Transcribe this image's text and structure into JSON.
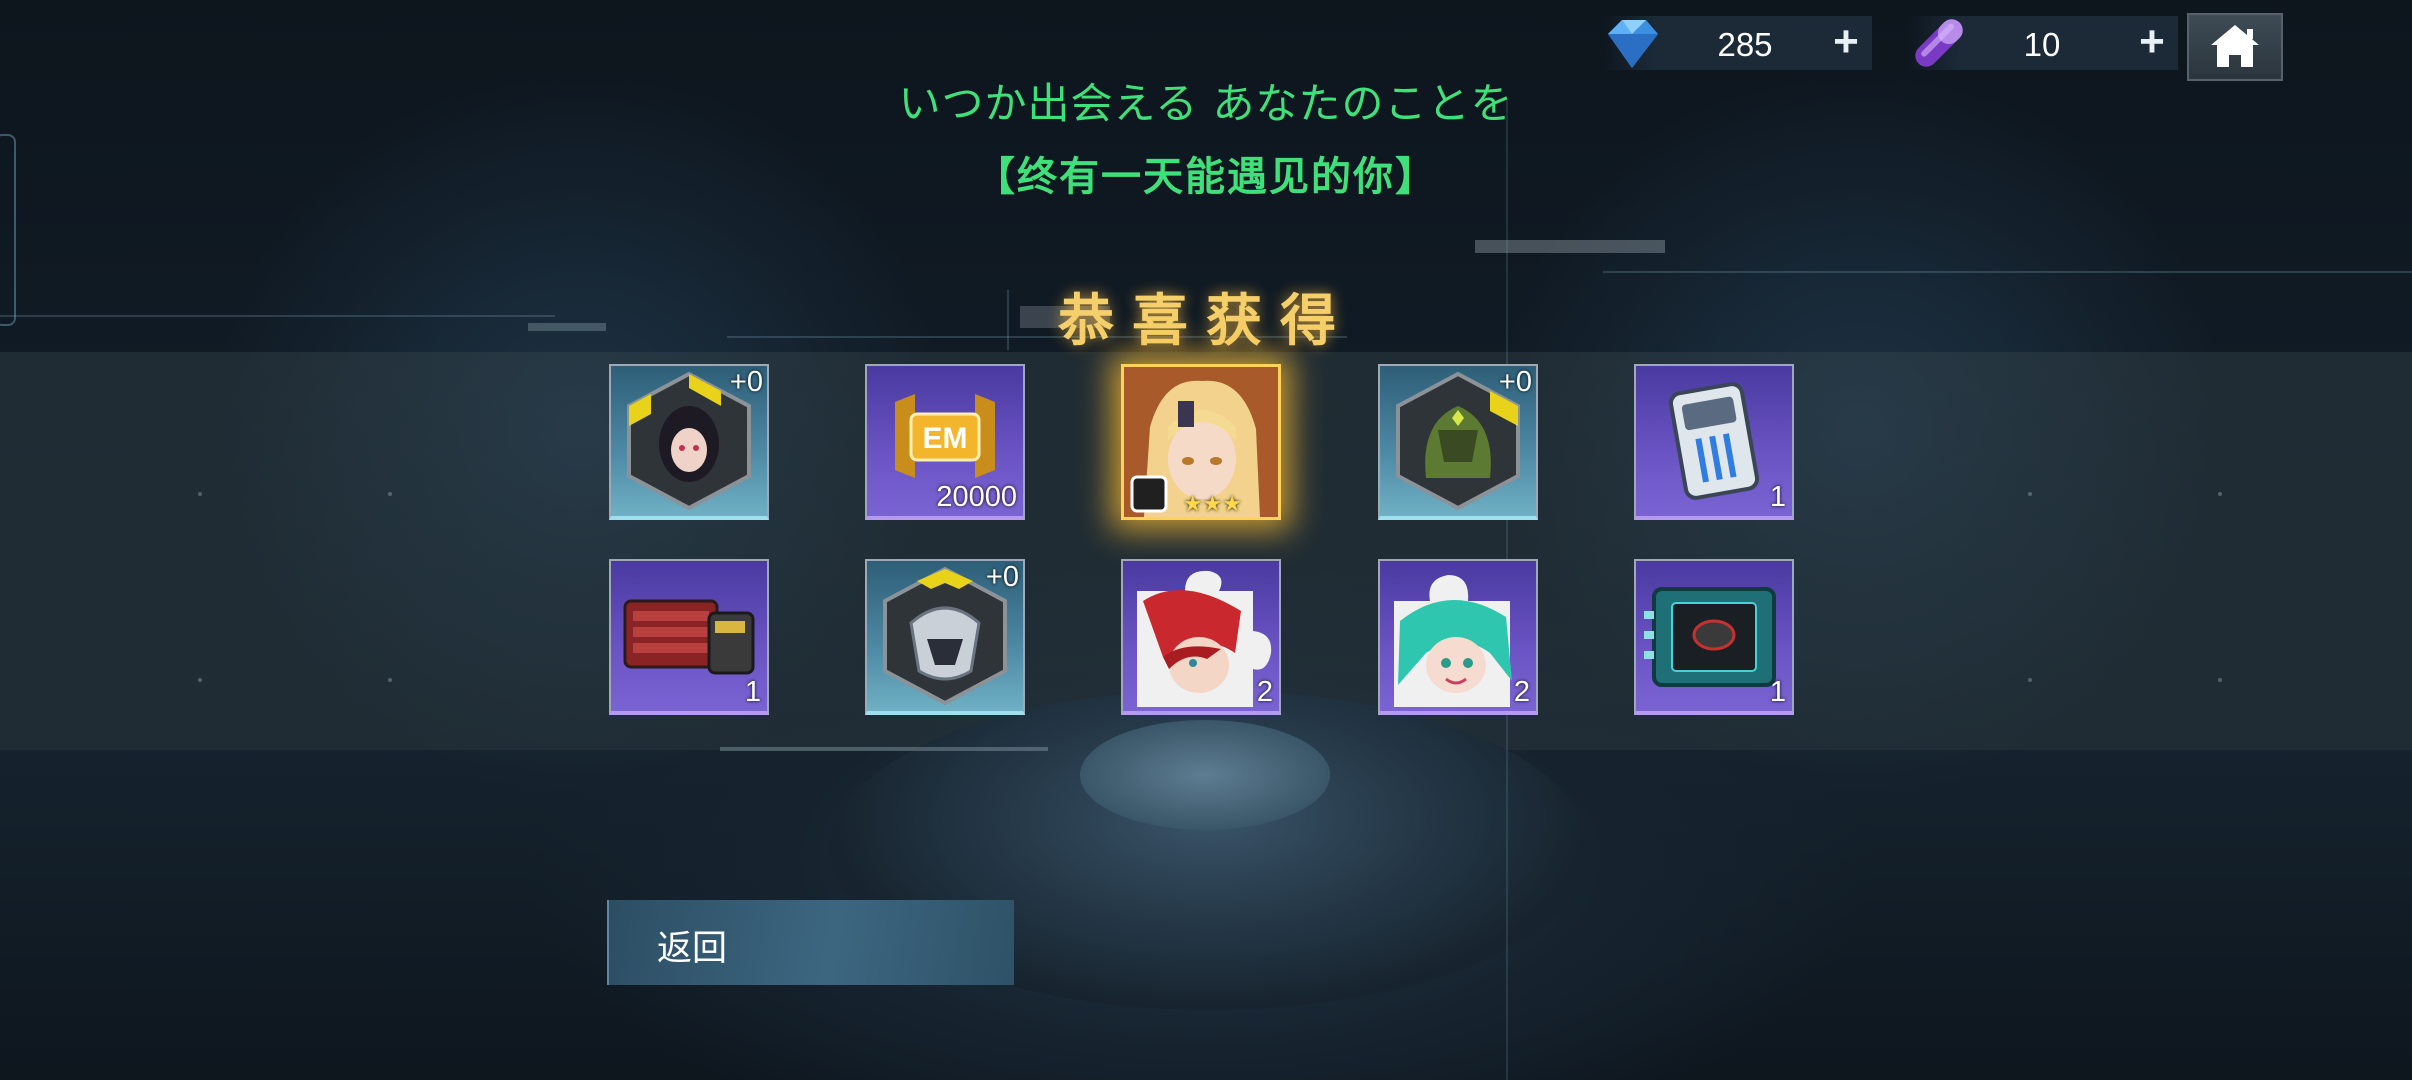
{
  "currency": {
    "gem_icon": "blue-gem-icon",
    "gem_value": "285",
    "capsule_icon": "purple-capsule-icon",
    "capsule_value": "10",
    "plus": "+",
    "home_icon": "home-icon"
  },
  "title_jp": "いつか出会える あなたのことを",
  "title_cn": "【终有一天能遇见的你】",
  "congrats": "恭喜获得",
  "rewards": [
    {
      "icon": "female-character-badge-icon",
      "badge": "+0",
      "qty": "",
      "rarity_color": "#4f8ba6"
    },
    {
      "icon": "em-token-icon",
      "badge": "",
      "qty": "20000",
      "rarity_color": "#6b54c4"
    },
    {
      "icon": "character-portrait-icon",
      "badge": "",
      "qty": "",
      "stars": "★★★",
      "rarity_color": "#ffd35a"
    },
    {
      "icon": "mech-helmet-badge-icon",
      "badge": "+0",
      "qty": "",
      "rarity_color": "#4f8ba6"
    },
    {
      "icon": "device-chip-icon",
      "badge": "",
      "qty": "1",
      "rarity_color": "#6b54c4"
    },
    {
      "icon": "battery-pack-icon",
      "badge": "",
      "qty": "1",
      "rarity_color": "#6b54c4"
    },
    {
      "icon": "armor-badge-icon",
      "badge": "+0",
      "qty": "",
      "rarity_color": "#4f8ba6"
    },
    {
      "icon": "red-hair-puzzle-piece-icon",
      "badge": "",
      "qty": "2",
      "rarity_color": "#6b54c4"
    },
    {
      "icon": "green-hair-puzzle-piece-icon",
      "badge": "",
      "qty": "2",
      "rarity_color": "#6b54c4"
    },
    {
      "icon": "processor-chip-icon",
      "badge": "",
      "qty": "1",
      "rarity_color": "#6b54c4"
    }
  ],
  "return_label": "返回"
}
